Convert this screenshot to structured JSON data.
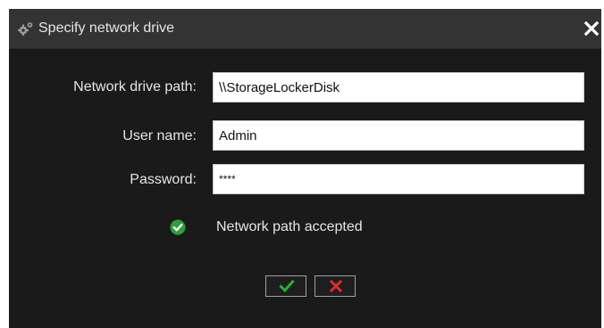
{
  "dialog": {
    "title": "Specify network drive",
    "title_icon": "gears-icon",
    "close_icon": "close-icon"
  },
  "form": {
    "path_label": "Network drive path:",
    "path_value": "\\\\StorageLockerDisk",
    "user_label": "User name:",
    "user_value": "Admin",
    "password_label": "Password:",
    "password_value": "****"
  },
  "status": {
    "text": "Network path accepted",
    "icon": "check-circle-icon",
    "color": "#2e9e3e"
  },
  "buttons": {
    "confirm_icon": "checkmark-icon",
    "confirm_color": "#2fae2f",
    "cancel_icon": "x-icon",
    "cancel_color": "#e02b2b"
  },
  "colors": {
    "background": "#1a1a1a",
    "titlebar": "#333333",
    "text": "#e6e6e6"
  }
}
